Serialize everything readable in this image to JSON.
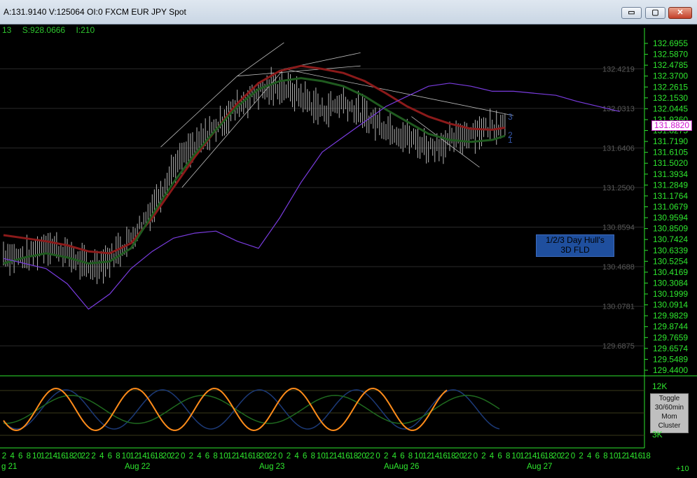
{
  "window": {
    "title": "A:131.9140 V:125064 OI:0 FXCM EUR JPY Spot",
    "buttons": {
      "minimize": "▭",
      "maximize": "▢",
      "close": "✕"
    }
  },
  "status": {
    "a": "13",
    "s": "S:928.0666",
    "i": "I:210"
  },
  "price_tag": "131.8820",
  "hull_box": {
    "line1": "1/2/3 Day Hull's",
    "line2": "3D FLD"
  },
  "toggle_box": {
    "line1": "Toggle",
    "line2": "30/60min",
    "line3": "Mom",
    "line4": "Cluster"
  },
  "indicator_axis": {
    "top": "12K",
    "bottom": "3K"
  },
  "scroll_label": "+10",
  "colors": {
    "axis": "#2ee62e",
    "bars": "#b4b4b4",
    "hull_red": "#8b1a1a",
    "hull_green": "#1f5a1f",
    "fld_purple": "#7a3ce0",
    "trendlines": "#bdbdbd",
    "osc_orange": "#ff8c1a",
    "osc_blue": "#1c3a78",
    "osc_green": "#1f6a1f"
  },
  "chart_data": {
    "type": "line",
    "y_axis_labels": [
      "132.6955",
      "132.5870",
      "132.4785",
      "132.3700",
      "132.2615",
      "132.1530",
      "132.0445",
      "131.9360",
      "131.8275",
      "131.7190",
      "131.6105",
      "131.5020",
      "131.3934",
      "131.2849",
      "131.1764",
      "131.0679",
      "130.9594",
      "130.8509",
      "130.7424",
      "130.6339",
      "130.5254",
      "130.4169",
      "130.3084",
      "130.1999",
      "130.0914",
      "129.9829",
      "129.8744",
      "129.7659",
      "129.6574",
      "129.5489",
      "129.4400"
    ],
    "ylim": [
      129.44,
      132.7
    ],
    "gridlines": [
      "132.4219",
      "132.0313",
      "131.6406",
      "131.2500",
      "130.8594",
      "130.4688",
      "130.0781",
      "129.6875"
    ],
    "hour_ticks": [
      "2",
      "4",
      "6",
      "8",
      "10",
      "12",
      "14",
      "16",
      "18",
      "20",
      "22",
      "2",
      "4",
      "6",
      "8",
      "10",
      "12",
      "14",
      "16",
      "18",
      "20",
      "22",
      "0",
      "2",
      "4",
      "6",
      "8",
      "10",
      "12",
      "14",
      "16",
      "18",
      "20",
      "22",
      "0",
      "2",
      "4",
      "6",
      "8",
      "10",
      "12",
      "14",
      "16",
      "18",
      "20",
      "22",
      "0",
      "2",
      "4",
      "6",
      "8",
      "10",
      "12",
      "14",
      "16",
      "18",
      "20",
      "22",
      "0",
      "2",
      "4",
      "6",
      "8",
      "10",
      "12",
      "14",
      "16",
      "18",
      "20",
      "22",
      "0",
      "2",
      "4",
      "6",
      "8",
      "10",
      "12",
      "14",
      "16",
      "18"
    ],
    "day_labels": [
      "g 21",
      "Aug 22",
      "Aug 23",
      "Au",
      "Aug 26",
      "Aug 27"
    ],
    "series": [
      {
        "name": "",
        "x": [
          0,
          5,
          10,
          15,
          20,
          25,
          30,
          35,
          40,
          45,
          50,
          55,
          60,
          65,
          70,
          75,
          80,
          85,
          90,
          95,
          100,
          105,
          110,
          115,
          118
        ],
        "values": [
          130.6,
          130.55,
          130.7,
          130.6,
          130.45,
          130.55,
          130.75,
          131.05,
          131.45,
          131.65,
          131.85,
          132.05,
          132.2,
          132.25,
          132.15,
          132.0,
          132.1,
          131.95,
          131.85,
          131.75,
          131.65,
          131.7,
          131.8,
          131.85,
          131.9
        ]
      },
      {
        "name": "",
        "x": [
          0,
          5,
          10,
          15,
          20,
          25,
          30,
          35,
          40,
          45,
          50,
          55,
          60,
          65,
          70,
          75,
          80,
          85,
          90,
          95,
          100,
          105,
          110,
          115,
          118
        ],
        "values": [
          130.78,
          130.75,
          130.72,
          130.68,
          130.62,
          130.6,
          130.7,
          130.95,
          131.25,
          131.55,
          131.82,
          132.08,
          132.28,
          132.4,
          132.45,
          132.42,
          132.38,
          132.3,
          132.18,
          132.05,
          131.95,
          131.88,
          131.83,
          131.82,
          131.84
        ]
      },
      {
        "name": "",
        "x": [
          0,
          5,
          10,
          15,
          20,
          25,
          30,
          35,
          40,
          45,
          50,
          55,
          60,
          65,
          70,
          75,
          80,
          85,
          90,
          95,
          100,
          105,
          110,
          115,
          118
        ],
        "values": [
          130.5,
          130.56,
          130.6,
          130.56,
          130.5,
          130.52,
          130.65,
          130.98,
          131.3,
          131.58,
          131.82,
          132.05,
          132.22,
          132.3,
          132.33,
          132.3,
          132.25,
          132.15,
          132.02,
          131.9,
          131.78,
          131.72,
          131.7,
          131.72,
          131.76
        ]
      },
      {
        "name": "",
        "x": [
          0,
          5,
          10,
          15,
          20,
          25,
          30,
          35,
          40,
          45,
          50,
          55,
          60,
          65,
          70,
          75,
          80,
          85,
          90,
          95,
          100,
          105,
          110,
          115,
          120,
          125,
          130,
          135,
          140,
          145
        ],
        "values": [
          130.55,
          130.5,
          130.45,
          130.3,
          130.05,
          130.2,
          130.45,
          130.62,
          130.75,
          130.8,
          130.82,
          130.72,
          130.65,
          130.95,
          131.3,
          131.6,
          131.75,
          131.9,
          132.05,
          132.15,
          132.25,
          132.28,
          132.25,
          132.2,
          132.2,
          132.18,
          132.16,
          132.1,
          132.05,
          132.0
        ]
      }
    ],
    "annotations": [
      "3",
      "2",
      "1"
    ],
    "oscillator": {
      "levels": [
        "12K",
        "3K"
      ]
    }
  }
}
